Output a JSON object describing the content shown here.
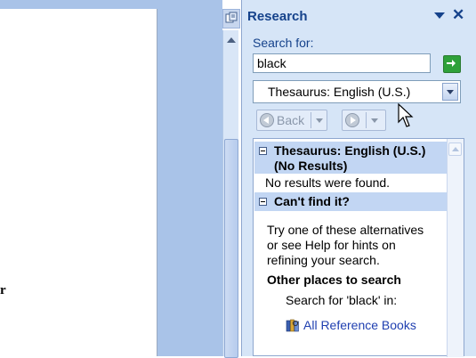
{
  "document": {
    "visible_char": "r"
  },
  "pane": {
    "title": "Research",
    "search_label": "Search for:",
    "search_value": "black",
    "source_selected": "Thesaurus: English (U.S.)",
    "back_label": "Back"
  },
  "results": {
    "section1_title_line1": "Thesaurus: English (U.S.)",
    "section1_title_line2": "(No Results)",
    "no_results": "No results were found.",
    "section2_title": "Can't find it?",
    "alt_line1": "Try one of these alternatives",
    "alt_line2": "or see Help for hints on",
    "alt_line3": "refining your search.",
    "other_places": "Other places to search",
    "search_for_prefix": "Search for 'black' in:",
    "all_books_link": "All Reference Books"
  },
  "colors": {
    "pane_bg": "#d6e5f7",
    "title_color": "#15428b",
    "link_color": "#1f3fb0",
    "section_header_bg": "#c2d6f3"
  },
  "icons": [
    "task-pane-split-icon",
    "dropdown-menu-icon",
    "close-icon",
    "go-arrow-icon",
    "back-icon",
    "forward-icon",
    "books-icon",
    "mouse-cursor-icon"
  ]
}
